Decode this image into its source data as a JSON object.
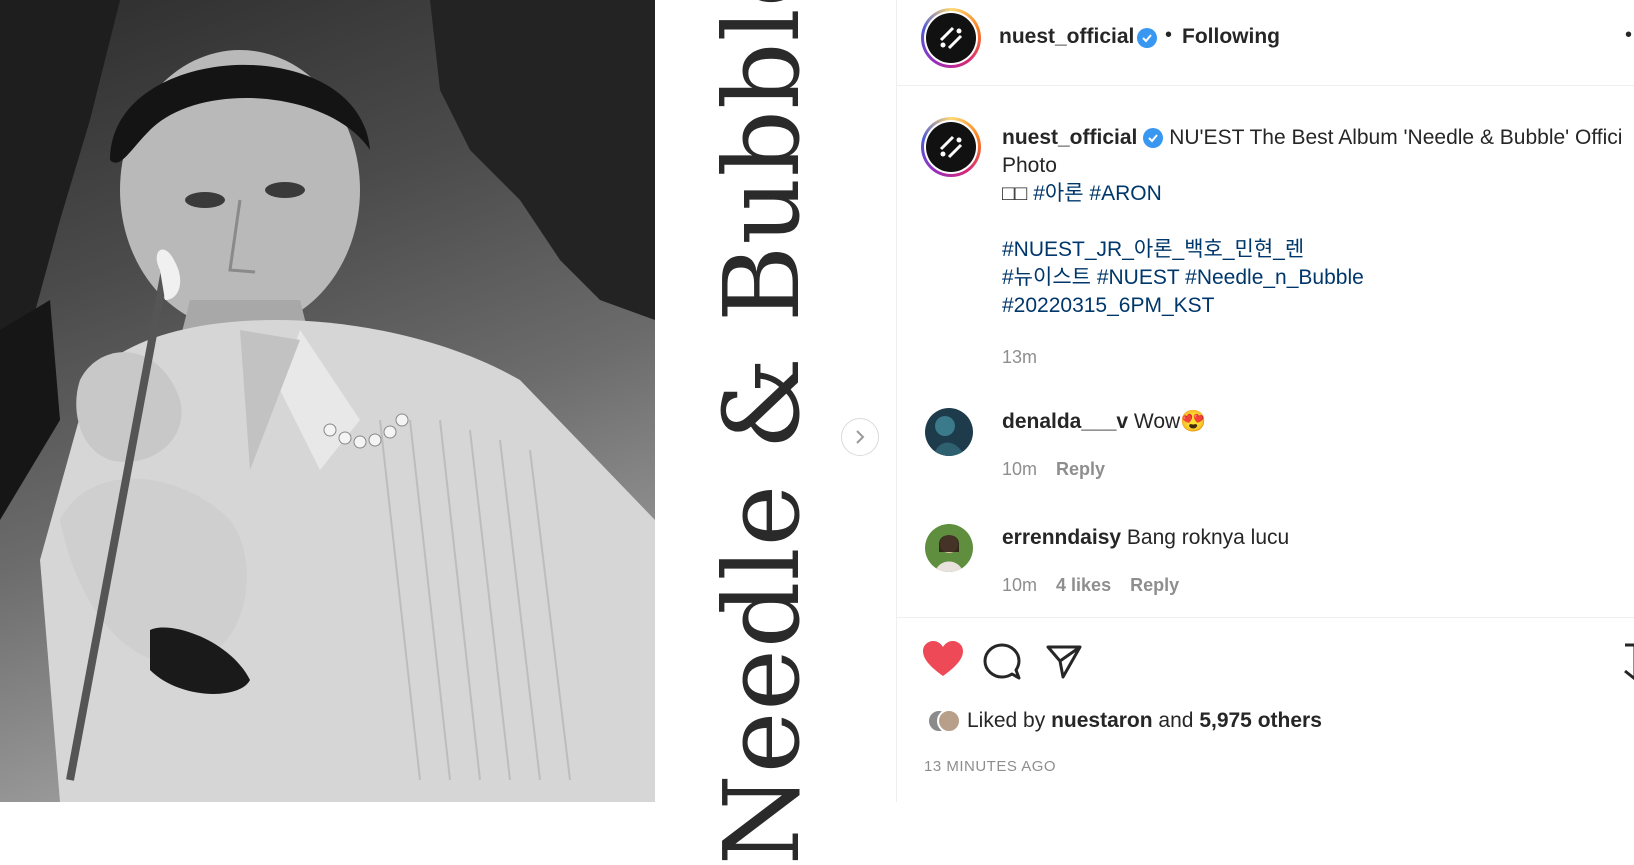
{
  "media": {
    "vertical_title": "Needle & Bubble"
  },
  "header": {
    "username": "nuest_official",
    "separator": "•",
    "follow_status": "Following",
    "more": "•"
  },
  "caption": {
    "username": "nuest_official",
    "text_line1": "NU'EST The Best Album 'Needle & Bubble' Offici",
    "text_line2": "Photo",
    "line3_prefix": "□□",
    "line3_tags": [
      "#아론",
      "#ARON"
    ],
    "tag_line4": "#NUEST_JR_아론_백호_민현_렌",
    "tag_line5": [
      "#뉴이스트",
      "#NUEST",
      "#Needle_n_Bubble"
    ],
    "tag_line6": "#20220315_6PM_KST",
    "time": "13m"
  },
  "comments": [
    {
      "username": "denalda___v",
      "text": "Wow😍",
      "time": "10m",
      "likes": "",
      "reply": "Reply"
    },
    {
      "username": "errenndaisy",
      "text": "Bang roknya lucu",
      "time": "10m",
      "likes": "4 likes",
      "reply": "Reply"
    }
  ],
  "likes": {
    "prefix": "Liked by",
    "user": "nuestaron",
    "middle": "and",
    "others": "5,975 others"
  },
  "posted": "13 MINUTES AGO",
  "colors": {
    "heart": "#ed4956",
    "hashtag": "#00376b",
    "verified": "#3897f0",
    "muted": "#8e8e8e"
  }
}
